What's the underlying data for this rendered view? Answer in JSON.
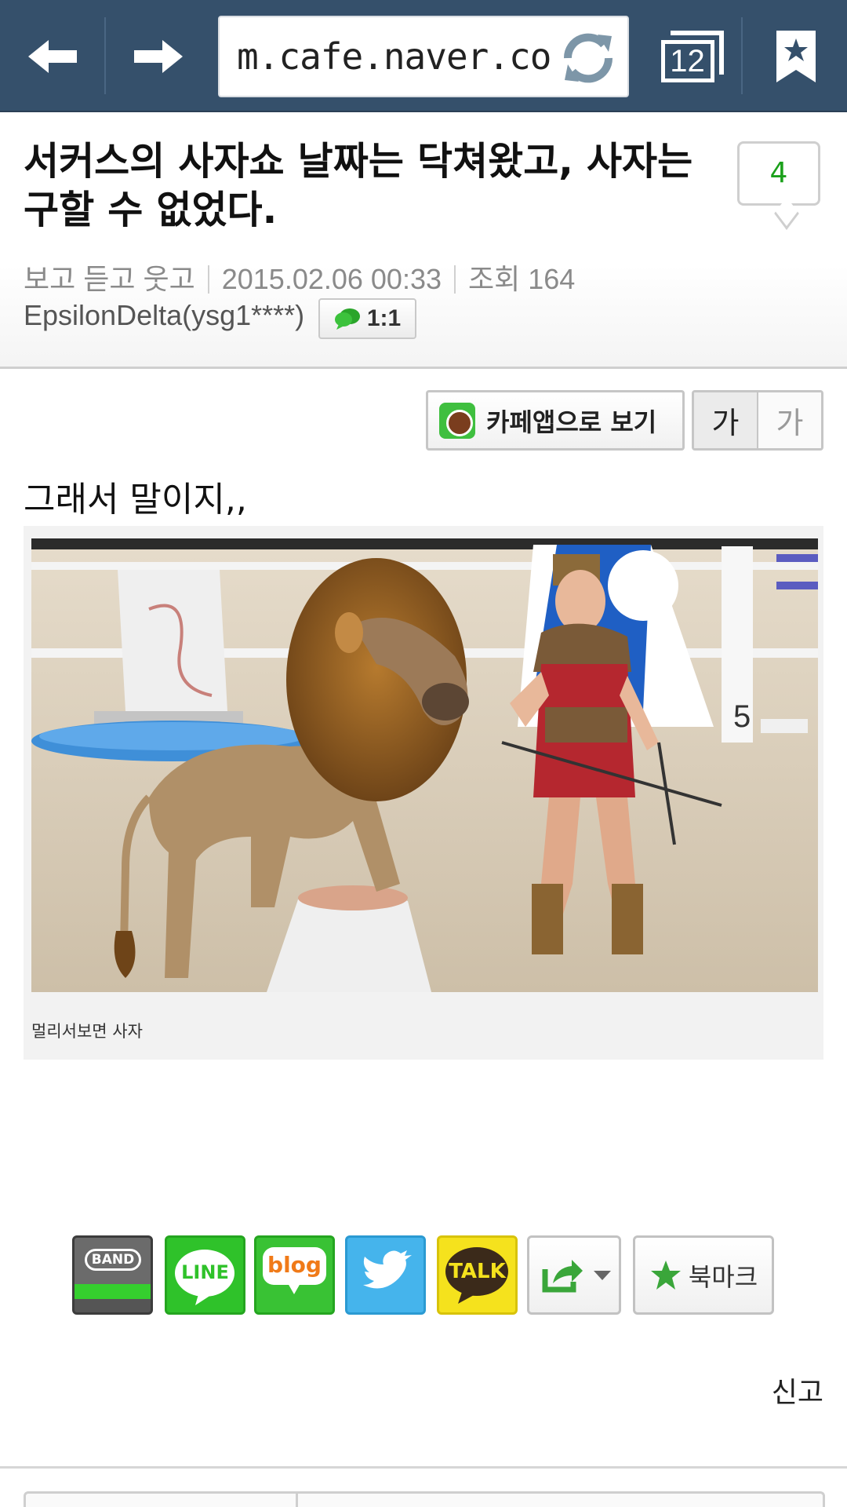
{
  "browser": {
    "url": "m.cafe.naver.co",
    "tab_count": "12"
  },
  "article": {
    "title": "서커스의 사자쇼 날짜는 닥쳐왔고, 사자는 구할 수 없었다.",
    "comment_count": "4",
    "board": "보고 듣고 웃고",
    "date": "2015.02.06 00:33",
    "views": "조회 164",
    "author": "EpsilonDelta(ysg1****)",
    "chat_label": "1:1"
  },
  "tools": {
    "cafe_app_label": "카페앱으로 보기",
    "font_small": "가",
    "font_large": "가"
  },
  "content": {
    "lead_text": "그래서 말이지,,",
    "image_caption": "멀리서보면 사자"
  },
  "share": {
    "band_label": "BAND",
    "line_label": "LINE",
    "blog_label": "blog",
    "talk_label": "TALK",
    "bookmark_label": "북마크"
  },
  "footer": {
    "report_label": "신고"
  },
  "colors": {
    "toolbar": "#35506b",
    "comment_count": "#1aa01a",
    "naver_green": "#2fc22a",
    "twitter_blue": "#45b4ec",
    "kakao_yellow": "#f5e21d"
  },
  "icons": [
    "back-arrow-icon",
    "forward-arrow-icon",
    "reload-icon",
    "tabs-icon",
    "bookmark-icon",
    "chat-bubble-icon",
    "cafe-app-icon",
    "share-icon",
    "chevron-down-icon",
    "star-icon"
  ]
}
